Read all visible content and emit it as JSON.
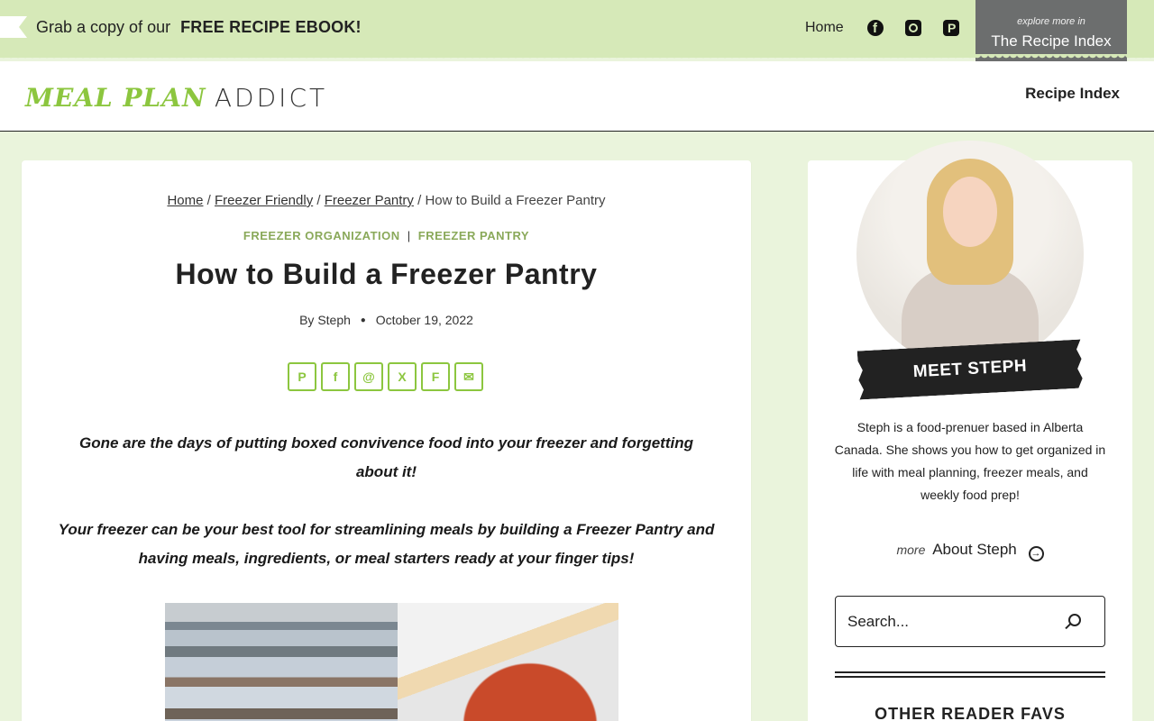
{
  "topbar": {
    "promo_prefix": "Grab a copy of our",
    "promo_link": "FREE RECIPE EBOOK!",
    "home_link": "Home",
    "socials": [
      "facebook-icon",
      "instagram-icon",
      "pinterest-icon"
    ],
    "recipe_box": {
      "small": "explore more in",
      "large": "The Recipe Index"
    }
  },
  "header": {
    "logo_part1": "MEAL PLAN",
    "logo_part2": "ADDICT",
    "nav_link": "Recipe Index"
  },
  "article": {
    "breadcrumb": {
      "items": [
        "Home",
        "Freezer Friendly",
        "Freezer Pantry"
      ],
      "current": "How to Build a Freezer Pantry",
      "separator": "/"
    },
    "categories": [
      "FREEZER ORGANIZATION",
      "FREEZER PANTRY"
    ],
    "category_separator": "|",
    "title": "How to Build a Freezer Pantry",
    "author_prefix": "By",
    "author": "Steph",
    "date": "October 19, 2022",
    "share_icons": [
      "pinterest-icon",
      "facebook-icon",
      "threads-icon",
      "x-icon",
      "flipboard-icon",
      "email-icon"
    ],
    "lead_1": "Gone are the days of putting boxed convivence food into your freezer and forgetting about it!",
    "lead_2": "Your freezer can be your best tool for streamlining meals by building a Freezer Pantry and having meals, ingredients, or meal starters ready at your finger tips!"
  },
  "sidebar": {
    "badge": "MEET STEPH",
    "bio": "Steph is a food-prenuer based in Alberta Canada. She shows you how to get organized in life with meal planning, freezer meals, and weekly food prep!",
    "about_prefix": "more",
    "about_link": "About Steph",
    "search_placeholder": "Search...",
    "favs_heading": "OTHER READER FAVS"
  },
  "colors": {
    "accent_green": "#8cc63f",
    "category_green": "#8aa95a",
    "topbar_bg": "#d6e9b8",
    "page_bg": "#eaf4dc",
    "recipe_box_bg": "#6c6e6e"
  }
}
